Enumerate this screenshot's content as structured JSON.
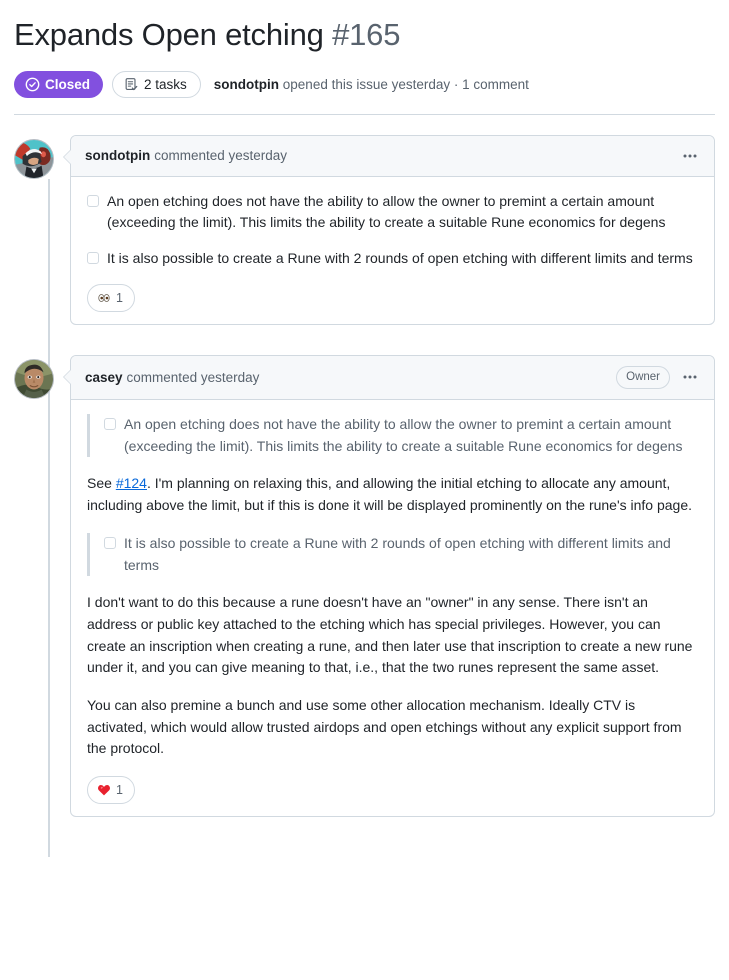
{
  "issue": {
    "title": "Expands Open etching",
    "number": "#165",
    "state_label": "Closed",
    "state_color": "#8250df",
    "tasks_label": "2 tasks",
    "meta_author": "sondotpin",
    "meta_text": " opened this issue yesterday · 1 comment"
  },
  "comments": [
    {
      "author": "sondotpin",
      "action": "commented yesterday",
      "owner_badge": null,
      "menu_label": "···",
      "tasks": [
        "An open etching does not have the ability to allow the owner to premint a certain amount (exceeding the limit). This limits the ability to create a suitable Rune economics for degens",
        "It is also possible to create a Rune with 2 rounds of open etching with different limits and terms"
      ],
      "reactions": [
        {
          "emoji_name": "eyes-emoji",
          "count": "1"
        }
      ]
    },
    {
      "author": "casey",
      "action": "commented yesterday",
      "owner_badge": "Owner",
      "menu_label": "···",
      "quote_1": "An open etching does not have the ability to allow the owner to premint a certain amount (exceeding the limit). This limits the ability to create a suitable Rune economics for degens",
      "para_1_before": "See ",
      "para_1_link": "#124",
      "para_1_after": ". I'm planning on relaxing this, and allowing the initial etching to allocate any amount, including above the limit, but if this is done it will be displayed prominently on the rune's info page.",
      "quote_2": "It is also possible to create a Rune with 2 rounds of open etching with different limits and terms",
      "para_2": "I don't want to do this because a rune doesn't have an \"owner\" in any sense. There isn't an address or public key attached to the etching which has special privileges. However, you can create an inscription when creating a rune, and then later use that inscription to create a new rune under it, and you can give meaning to that, i.e., that the two runes represent the same asset.",
      "para_3": "You can also premine a bunch and use some other allocation mechanism. Ideally CTV is activated, which would allow trusted airdops and open etchings without any explicit support from the protocol.",
      "reactions": [
        {
          "emoji_name": "heart-emoji",
          "count": "1"
        }
      ]
    }
  ],
  "colors": {
    "link": "#0969da",
    "muted": "#59636e",
    "border": "#d1d9e0",
    "header_bg": "#f6f8fa",
    "text": "#1f2328"
  }
}
